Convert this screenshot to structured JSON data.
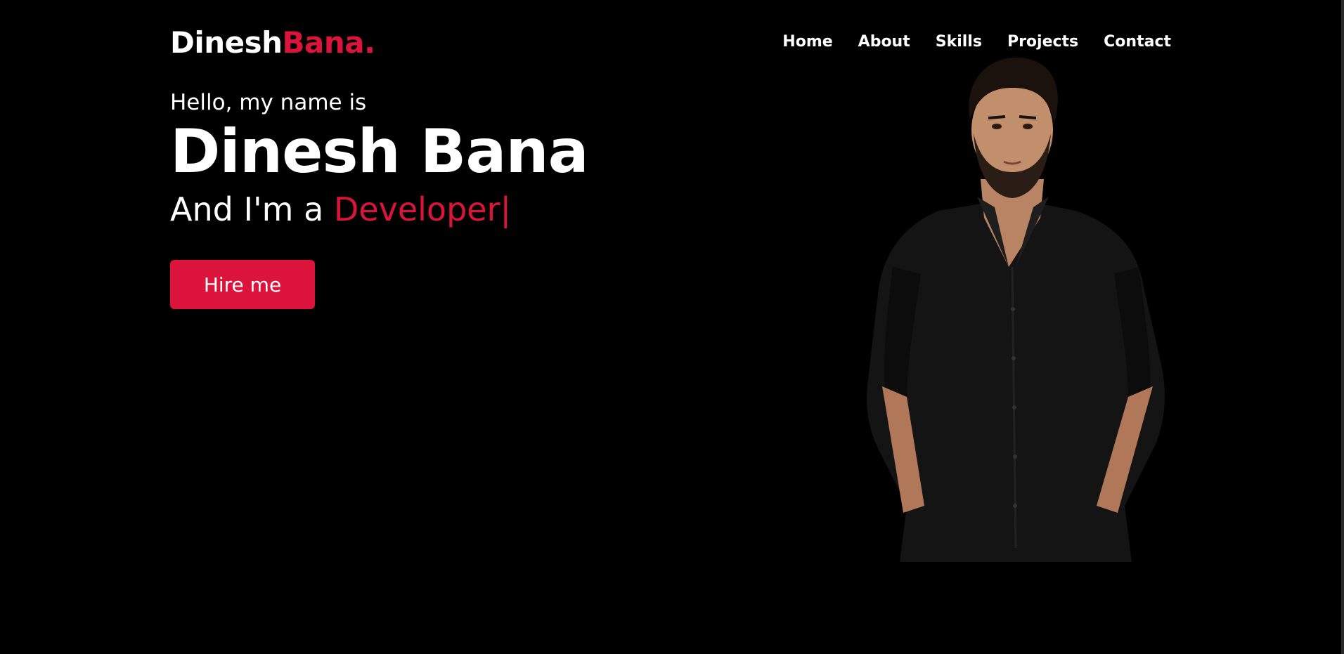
{
  "header": {
    "logo_primary": "Dinesh",
    "logo_accent": "Bana."
  },
  "nav": {
    "items": [
      "Home",
      "About",
      "Skills",
      "Projects",
      "Contact"
    ]
  },
  "hero": {
    "greeting": "Hello, my name is",
    "name": "Dinesh Bana",
    "tagline_prefix": "And I'm a ",
    "role": "Developer",
    "cursor": "|",
    "cta_label": "Hire me"
  },
  "colors": {
    "accent": "#dc143c",
    "background": "#000000",
    "text": "#ffffff"
  }
}
